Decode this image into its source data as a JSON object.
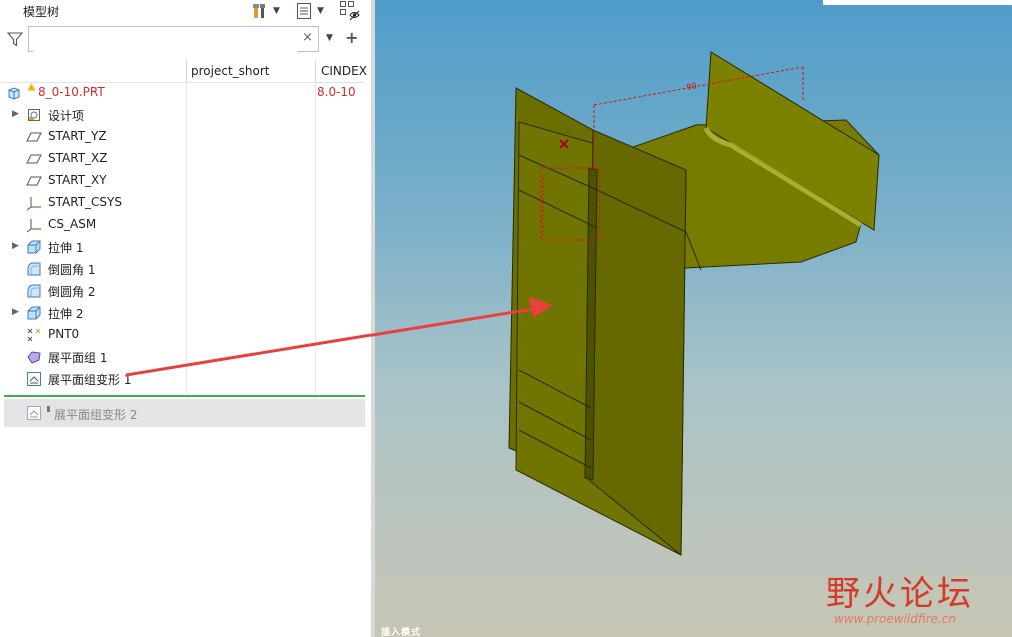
{
  "panel": {
    "title": "模型树",
    "search_placeholder": "",
    "clear_symbol": "×",
    "add_symbol": "+",
    "dropdown_symbol": "▼"
  },
  "columns": [
    "project_short",
    "CINDEX"
  ],
  "tree": {
    "root": {
      "label": "8_0-10.PRT",
      "cindex": "8.0-10"
    },
    "items": [
      {
        "label": "设计项",
        "icon": "design-items-icon",
        "expandable": true
      },
      {
        "label": "START_YZ",
        "icon": "datum-plane-icon",
        "expandable": false
      },
      {
        "label": "START_XZ",
        "icon": "datum-plane-icon",
        "expandable": false
      },
      {
        "label": "START_XY",
        "icon": "datum-plane-icon",
        "expandable": false
      },
      {
        "label": "START_CSYS",
        "icon": "csys-icon",
        "expandable": false
      },
      {
        "label": "CS_ASM",
        "icon": "csys-icon",
        "expandable": false
      },
      {
        "label": "拉伸 1",
        "icon": "extrude-icon",
        "expandable": true
      },
      {
        "label": "倒圆角 1",
        "icon": "round-icon",
        "expandable": false
      },
      {
        "label": "倒圆角 2",
        "icon": "round-icon",
        "expandable": false
      },
      {
        "label": "拉伸 2",
        "icon": "extrude-icon",
        "expandable": true
      },
      {
        "label": "PNT0",
        "icon": "datum-point-icon",
        "expandable": false
      },
      {
        "label": "展平面组 1",
        "icon": "flatten-quilt-icon",
        "expandable": false
      },
      {
        "label": "展平面组变形 1",
        "icon": "flatten-deform-icon",
        "expandable": false
      }
    ],
    "suppressed_item": {
      "label": "展平面组变形 2",
      "icon": "flatten-deform-icon"
    }
  },
  "viewport": {
    "dimension_value": "90",
    "mode_label": "插入模式"
  },
  "watermark": {
    "text": "野火论坛",
    "url": "www.proewildfire.cn"
  },
  "colors": {
    "model_face": "#6d7100",
    "model_face_light": "#7e8200",
    "model_edge": "#2a2a00",
    "dimension": "#e01010",
    "arrow": "#e8403a",
    "insert_line": "#3cb04a"
  }
}
